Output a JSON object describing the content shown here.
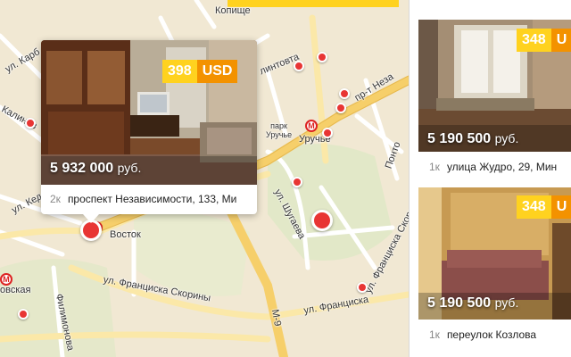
{
  "map": {
    "labels": {
      "kopishche": "Копище",
      "karbysheva": "ул. Карб",
      "kalinovskogo": "Калинов",
      "kedyshko": "ул. Кед",
      "vostok": "Восток",
      "vostok_area": "овская",
      "lintovta": "линтовта",
      "pr_nezav": "пр-т Неза",
      "park_uruchye": "парк\nУручье",
      "uruchye": "Уручье",
      "pontonnaya": "Понто",
      "shugaeva": "ул. Шугаева",
      "skoriny_1": "ул. Франциска Скорины",
      "skoriny_2": "ул. Франциска Скорины",
      "skoriny_3": "ул. Франциска",
      "filimonova": "Филимонова",
      "m9": "М-9"
    }
  },
  "popup": {
    "price_usd": "398",
    "currency": "USD",
    "price_rub": "5 932 000",
    "rub_suffix": "руб.",
    "rooms": "2к",
    "address": "проспект Независимости, 133, Ми"
  },
  "listings": [
    {
      "price_usd": "348",
      "currency": "U",
      "price_rub": "5 190 500",
      "rub_suffix": "руб.",
      "rooms": "1к",
      "address": "улица Жудро, 29, Мин"
    },
    {
      "price_usd": "348",
      "currency": "U",
      "price_rub": "5 190 500",
      "rub_suffix": "руб.",
      "rooms": "1к",
      "address": "переулок Козлова"
    }
  ],
  "colors": {
    "price_yellow": "#ffd21f",
    "currency_orange": "#f39200",
    "pin_red": "#e83534",
    "major_road": "#f6cf6a"
  }
}
